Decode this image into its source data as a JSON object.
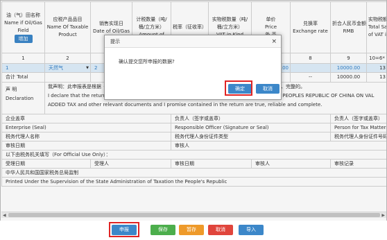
{
  "header": {
    "col1_cn": "油（气）田名称",
    "col1_en1": "Name if Oil/Gas",
    "col1_en2": "Field",
    "add_label": "增加",
    "col2_cn": "应税产品品目",
    "col2_en1": "Name Of Taxable",
    "col2_en2": "Product",
    "col3_cn": "销售实现日",
    "col3_en": "Date of Oil/Gas",
    "col4_cn1": "计税数量（吨/",
    "col4_cn2": "桶/立方米）",
    "col4_en": "Amount of",
    "col5_cn": "税率（征收率）",
    "col6_cn1": "实物税数量（吨/",
    "col6_cn2": "桶/立方米）",
    "col6_en": "VAT in Kind",
    "price_cn": "单价",
    "price_en": "Price",
    "fc_cn": "外 币",
    "rate_cn": "兑换率",
    "rate_en": "Exchange rate",
    "rmb_cn": "折合人民币金额",
    "rmb_en": "RMB",
    "last_cn": "实物税额",
    "last_en1": "Total Sale",
    "last_en2": "of VAT in"
  },
  "index_row": [
    "1",
    "2",
    "",
    "",
    "",
    "",
    "",
    "8",
    "9",
    "10=6*"
  ],
  "data_row": {
    "num": "1",
    "product": "天然气",
    "date_prefix": "2",
    "fc": "0.00",
    "rmb": "10000.00",
    "last": "13"
  },
  "total_row": {
    "label": "合计 Total",
    "dash1": "--",
    "dash2": "--",
    "rmb": "10000.00",
    "last": "13"
  },
  "declaration": {
    "label_cn": "声 明",
    "label_en": "Declaration",
    "line_cn": "我声明：此申报表是根据《中华人民共和国增值税暂行条例》及有关规定填报的，我确信它是真实的、可靠的、完整的。",
    "line_en1": "I declare that the return is filled out in accordance with the PROVISIONAL REGULATIONS OF THE PEOPLES REPUBLIC OF CHINA ON VAL",
    "line_en2": "ADDED TAX and other relevant documents and I promise contained in the return are true, reliable and complete."
  },
  "sign": {
    "seal_cn": "企业盖章",
    "seal_en": "Enterprise (Seal)",
    "resp_cn": "负责人（签字或盖章）",
    "resp_en": "Responsible Officer (Signature or Seal)",
    "person_cn": "负责人（签字或盖章）",
    "person_en": "Person for Tax Matters (Sign",
    "agent_name": "税务代理人名称",
    "agent_id_type": "税务代理人身份证件类型",
    "agent_id_no": "税务代理人身份证件号码",
    "audit_date": "审核日期",
    "auditor": "审核人"
  },
  "official": {
    "title": "以下由税务机关填写（For Official Use Only）：",
    "accept_date": "受理日期",
    "acceptor": "受理人",
    "audit_date": "审核日期",
    "auditor": "审核人",
    "audit_record": "审核记录"
  },
  "footer": {
    "cn": "中华人民共和国国家税务总局监制",
    "en": "Printed Under the Supervision of the State Administration of Taxation the People's Republic"
  },
  "modal": {
    "title": "提示",
    "message": "确认提交您所申报的数据?",
    "ok": "确定",
    "cancel": "取消",
    "close": "×"
  },
  "buttons": {
    "submit": "申报",
    "save": "保存",
    "temp_save": "暂存",
    "cancel": "取消",
    "import": "导入"
  },
  "colors": {
    "blue": "#3c87c9",
    "green": "#4cae4c",
    "orange": "#ee9a2a",
    "red": "#e0453c",
    "highlight": "#e02424"
  }
}
